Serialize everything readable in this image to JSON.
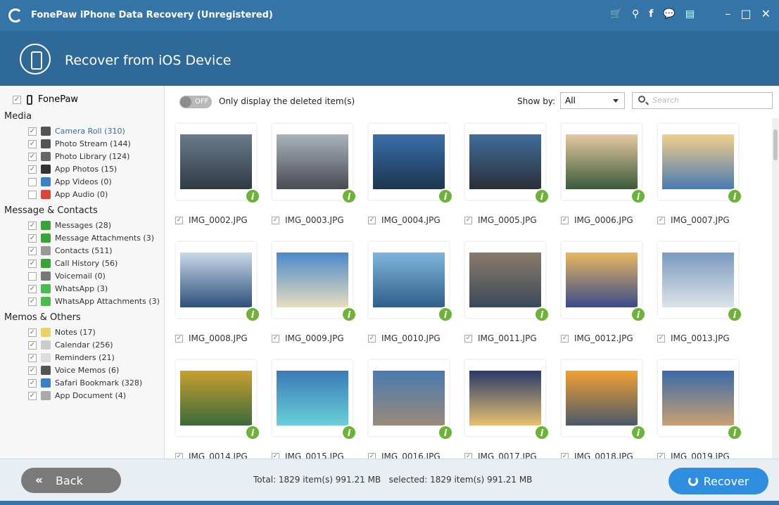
{
  "window": {
    "title": "FonePaw iPhone Data Recovery (Unregistered)",
    "toolbar_icons": [
      "cart-icon",
      "key-icon",
      "facebook-icon",
      "chat-icon",
      "register-icon"
    ],
    "controls": [
      "minimize-icon",
      "maximize-icon",
      "close-icon"
    ]
  },
  "header": {
    "title": "Recover from iOS Device"
  },
  "sidebar": {
    "root_label": "FonePaw",
    "groups": [
      {
        "title": "Media",
        "items": [
          {
            "label": "Camera Roll (310)",
            "checked": true,
            "icon": "camera-icon",
            "color": "#555555",
            "active": true
          },
          {
            "label": "Photo Stream (144)",
            "checked": true,
            "icon": "photo-stream-icon",
            "color": "#555555"
          },
          {
            "label": "Photo Library (124)",
            "checked": true,
            "icon": "photo-library-icon",
            "color": "#666666"
          },
          {
            "label": "App Photos (15)",
            "checked": true,
            "icon": "app-photos-icon",
            "color": "#333333"
          },
          {
            "label": "App Videos (0)",
            "checked": false,
            "icon": "app-videos-icon",
            "color": "#3b7fc4"
          },
          {
            "label": "App Audio (0)",
            "checked": false,
            "icon": "app-audio-icon",
            "color": "#d9453b"
          }
        ]
      },
      {
        "title": "Message & Contacts",
        "items": [
          {
            "label": "Messages (28)",
            "checked": true,
            "icon": "messages-icon",
            "color": "#3aa33a"
          },
          {
            "label": "Message Attachments (3)",
            "checked": true,
            "icon": "message-attachments-icon",
            "color": "#3aa33a"
          },
          {
            "label": "Contacts (511)",
            "checked": true,
            "icon": "contacts-icon",
            "color": "#999999"
          },
          {
            "label": "Call History (56)",
            "checked": true,
            "icon": "call-history-icon",
            "color": "#3aa33a"
          },
          {
            "label": "Voicemail (0)",
            "checked": false,
            "icon": "voicemail-icon",
            "color": "#777777"
          },
          {
            "label": "WhatsApp (3)",
            "checked": true,
            "icon": "whatsapp-icon",
            "color": "#4cbb4c"
          },
          {
            "label": "WhatsApp Attachments (3)",
            "checked": true,
            "icon": "whatsapp-attachments-icon",
            "color": "#4cbb4c"
          }
        ]
      },
      {
        "title": "Memos & Others",
        "items": [
          {
            "label": "Notes (17)",
            "checked": true,
            "icon": "notes-icon",
            "color": "#e8d36a"
          },
          {
            "label": "Calendar (256)",
            "checked": true,
            "icon": "calendar-icon",
            "color": "#cccccc"
          },
          {
            "label": "Reminders (21)",
            "checked": true,
            "icon": "reminders-icon",
            "color": "#dddddd"
          },
          {
            "label": "Voice Memos (6)",
            "checked": true,
            "icon": "voice-memos-icon",
            "color": "#555555"
          },
          {
            "label": "Safari Bookmark (328)",
            "checked": true,
            "icon": "safari-bookmark-icon",
            "color": "#3b7fc4"
          },
          {
            "label": "App Document (4)",
            "checked": true,
            "icon": "app-document-icon",
            "color": "#aaaaaa"
          }
        ]
      }
    ]
  },
  "toolbar": {
    "toggle_state": "OFF",
    "toggle_label": "Only display the deleted item(s)",
    "show_by_label": "Show by:",
    "show_by_value": "All",
    "search_placeholder": "Search"
  },
  "files": [
    {
      "name": "IMG_0002.JPG",
      "colors": [
        "#6b7b8c",
        "#2f3a44"
      ]
    },
    {
      "name": "IMG_0003.JPG",
      "colors": [
        "#aab3bd",
        "#4a4a52"
      ]
    },
    {
      "name": "IMG_0004.JPG",
      "colors": [
        "#3a6ea8",
        "#1e3550"
      ]
    },
    {
      "name": "IMG_0005.JPG",
      "colors": [
        "#3f6e9c",
        "#2a2f38"
      ]
    },
    {
      "name": "IMG_0006.JPG",
      "colors": [
        "#e6c9a0",
        "#3a5a3a"
      ]
    },
    {
      "name": "IMG_0007.JPG",
      "colors": [
        "#f2d08a",
        "#4a7ab0"
      ]
    },
    {
      "name": "IMG_0008.JPG",
      "colors": [
        "#c9d9ea",
        "#2e4f7a"
      ]
    },
    {
      "name": "IMG_0009.JPG",
      "colors": [
        "#4a8ac8",
        "#e8dcc0"
      ]
    },
    {
      "name": "IMG_0010.JPG",
      "colors": [
        "#7fb5dc",
        "#2f5f8a"
      ]
    },
    {
      "name": "IMG_0011.JPG",
      "colors": [
        "#8a7a6a",
        "#3a4a5a"
      ]
    },
    {
      "name": "IMG_0012.JPG",
      "colors": [
        "#e8b860",
        "#3a4a8a"
      ]
    },
    {
      "name": "IMG_0013.JPG",
      "colors": [
        "#7a9ac0",
        "#dde4ea"
      ]
    },
    {
      "name": "IMG_0014.JPG",
      "colors": [
        "#c8a030",
        "#3a6a3a"
      ]
    },
    {
      "name": "IMG_0015.JPG",
      "colors": [
        "#3a7ab8",
        "#6ad0d8"
      ]
    },
    {
      "name": "IMG_0016.JPG",
      "colors": [
        "#4a7ab0",
        "#9a8a7a"
      ]
    },
    {
      "name": "IMG_0017.JPG",
      "colors": [
        "#2a3a6a",
        "#e8c070"
      ]
    },
    {
      "name": "IMG_0018.JPG",
      "colors": [
        "#f0a030",
        "#4a5a6a"
      ]
    },
    {
      "name": "IMG_0019.JPG",
      "colors": [
        "#3a6aa8",
        "#c8a070"
      ]
    }
  ],
  "footer": {
    "back_label": "Back",
    "totals": "Total: 1829 item(s) 991.21 MB   selected: 1829 item(s) 991.21 MB",
    "recover_label": "Recover"
  },
  "colors": {
    "titlebar": "#3574a6",
    "header": "#2f6998",
    "recover_button": "#2f8ee0",
    "back_button": "#7a7a7a",
    "badge": "#6cb338"
  }
}
